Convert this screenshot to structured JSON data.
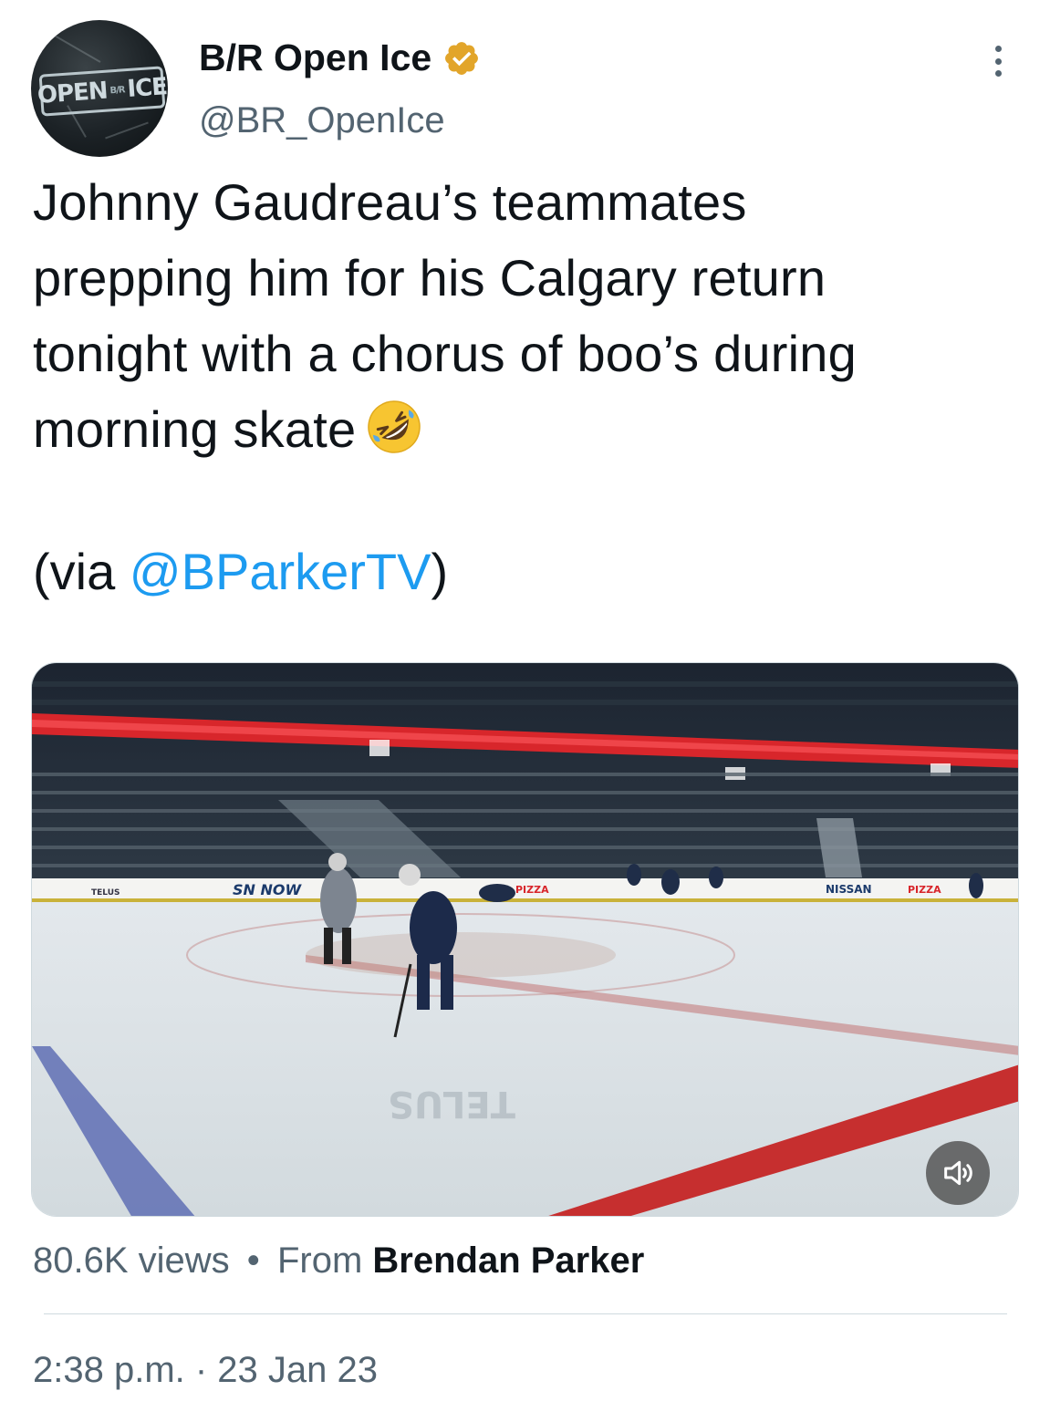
{
  "account": {
    "display_name": "B/R Open Ice",
    "handle": "@BR_OpenIce",
    "verified_icon": "verified-badge-icon",
    "avatar_icon": "open-ice-logo",
    "avatar_text": "OPEN B/R ICE"
  },
  "tweet": {
    "lines": [
      "Johnny Gaudreau’s teammates",
      "prepping him for his Calgary return",
      "tonight with a chorus of boo’s during",
      "morning skate"
    ],
    "emoji": "rolling-on-floor-laughing-emoji",
    "via_prefix": "(via ",
    "via_mention": "@BParkerTV",
    "via_suffix": ")"
  },
  "media": {
    "type": "video",
    "description_icon": "video-thumbnail",
    "sound_icon": "speaker-icon"
  },
  "stats": {
    "views": "80.6K views",
    "separator": "•",
    "from_label": "From",
    "from_name": "Brendan Parker"
  },
  "timestamp": "2:38 p.m. · 23 Jan 23",
  "colors": {
    "text": "#0f1419",
    "secondary": "#536471",
    "link": "#1d9bf0",
    "verified": "#e2a52a"
  }
}
